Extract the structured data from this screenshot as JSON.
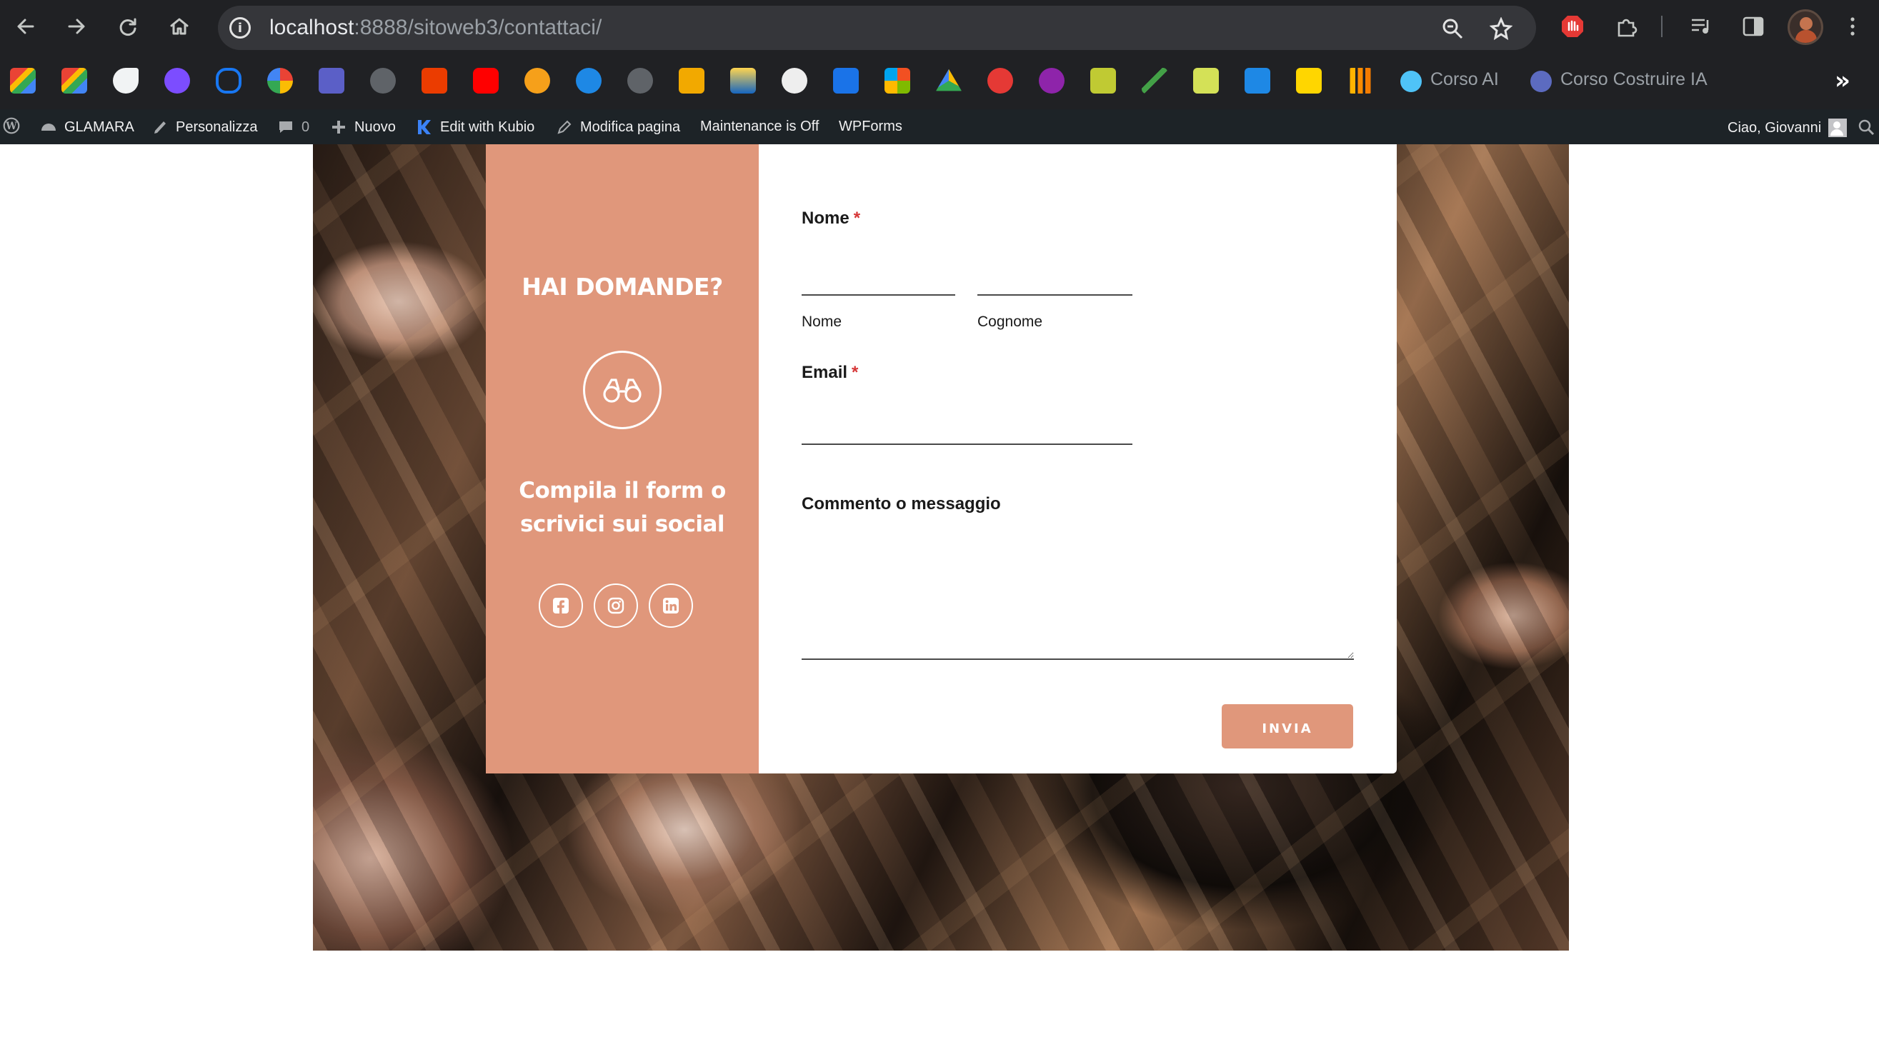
{
  "browser": {
    "url_host": "localhost",
    "url_path": ":8888/sitoweb3/contattaci/",
    "bookmarks_labeled": [
      {
        "label": "Corso AI",
        "dot_color": "#4fc3f7"
      },
      {
        "label": "Corso Costruire IA",
        "dot_color": "#5c6bc0"
      }
    ],
    "more_glyph": "»"
  },
  "adminbar": {
    "site_name": "GLAMARA",
    "customize": "Personalizza",
    "comments_count": "0",
    "new": "Nuovo",
    "kubio": "Edit with Kubio",
    "edit_page": "Modifica pagina",
    "maintenance": "Maintenance is Off",
    "wpforms": "WPForms",
    "greeting": "Ciao, Giovanni"
  },
  "sidebar": {
    "title": "HAI DOMANDE?",
    "icon": "binoculars-icon",
    "subtitle": "Compila il form o scrivici sui social",
    "social": [
      "facebook-icon",
      "instagram-icon",
      "linkedin-icon"
    ]
  },
  "form": {
    "name_label": "Nome",
    "required_mark": "*",
    "first_name_sublabel": "Nome",
    "last_name_sublabel": "Cognome",
    "email_label": "Email",
    "message_label": "Commento o messaggio",
    "submit_label": "INVIA"
  },
  "colors": {
    "accent": "#e0977b",
    "required": "#d63637",
    "chrome_bg": "#202124",
    "adminbar_bg": "#1d2327"
  }
}
